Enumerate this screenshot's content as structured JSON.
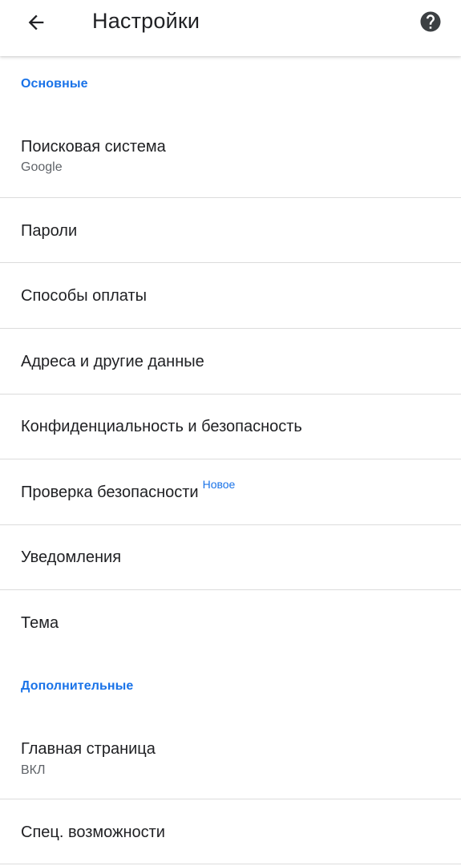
{
  "app_bar": {
    "title": "Настройки",
    "back_icon": "arrow-left-icon",
    "help_icon": "help-circle-icon"
  },
  "sections": {
    "basic": "Основные",
    "advanced": "Дополнительные"
  },
  "items": {
    "search_engine": {
      "label": "Поисковая система",
      "value": "Google"
    },
    "passwords": {
      "label": "Пароли"
    },
    "payment": {
      "label": "Способы оплаты"
    },
    "addresses": {
      "label": "Адреса и другие данные"
    },
    "privacy": {
      "label": "Конфиденциальность и безопасность"
    },
    "safety_check": {
      "label": "Проверка безопасности",
      "badge": "Новое"
    },
    "notifications": {
      "label": "Уведомления"
    },
    "theme": {
      "label": "Тема"
    },
    "homepage": {
      "label": "Главная страница",
      "value": "ВКЛ"
    },
    "accessibility": {
      "label": "Спец. возможности"
    }
  },
  "colors": {
    "accent": "#1a73e8",
    "text_primary": "#202124",
    "text_secondary": "#5f6368",
    "divider": "#dcdcdc"
  }
}
